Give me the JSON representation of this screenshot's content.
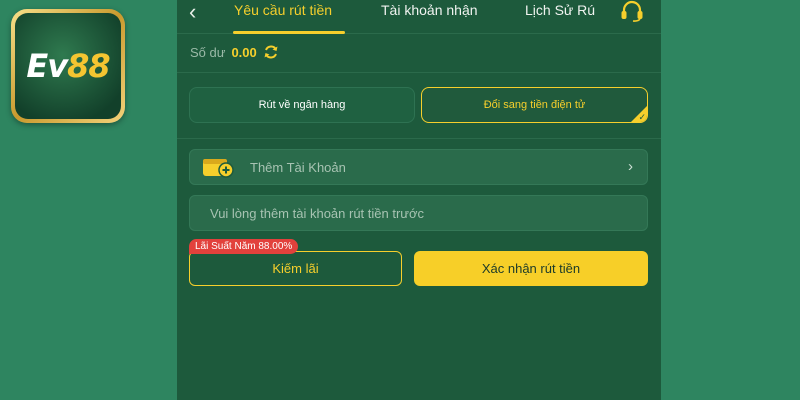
{
  "logo": {
    "text_main": "Ev",
    "text_accent": "88"
  },
  "nav": {
    "back_glyph": "‹",
    "tabs": [
      {
        "label": "Yêu cầu rút tiền",
        "active": true
      },
      {
        "label": "Tài khoản nhận",
        "active": false
      },
      {
        "label": "Lịch Sử Rú",
        "active": false
      }
    ],
    "support_icon": "headset-icon"
  },
  "balance": {
    "label": "Số dư",
    "value": "0.00",
    "icon": "refresh-icon"
  },
  "options": [
    {
      "label": "Rút về ngân hàng",
      "selected": false
    },
    {
      "label": "Đổi sang tiền điện tử",
      "selected": true
    }
  ],
  "account": {
    "add_label": "Thêm Tài Khoản",
    "icon": "wallet-add-icon",
    "chevron": "›"
  },
  "notice": "Vui lòng thêm tài khoản rút tiền trước",
  "interest_badge": "Lãi Suất Năm 88.00%",
  "buttons": {
    "earn": "Kiếm lãi",
    "confirm": "Xác nhận rút tiền"
  },
  "colors": {
    "background": "#2e8560",
    "panel": "#1d5a3c",
    "accent": "#f6cf2c",
    "badge": "#e2413c"
  }
}
